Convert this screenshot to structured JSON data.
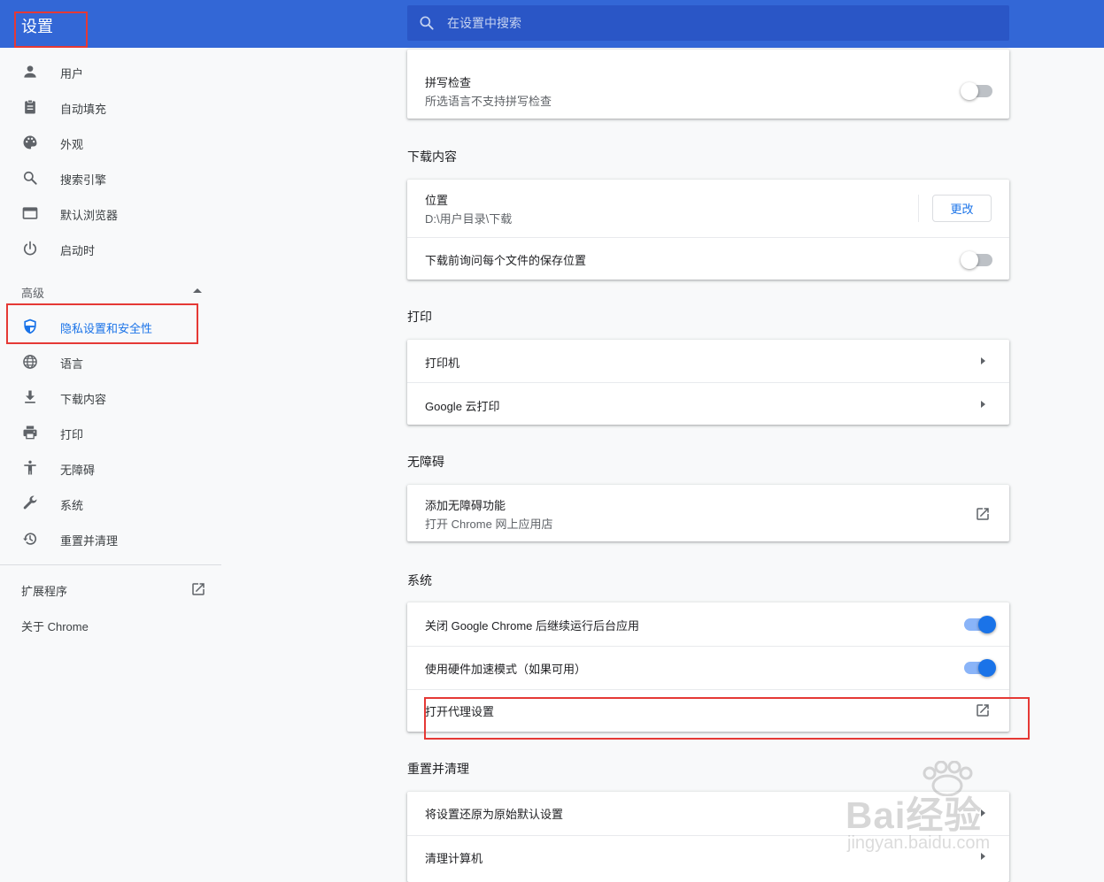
{
  "header": {
    "title": "设置",
    "search_placeholder": "在设置中搜索"
  },
  "sidebar": {
    "items": [
      {
        "label": "用户",
        "icon": "person-icon"
      },
      {
        "label": "自动填充",
        "icon": "clipboard-icon"
      },
      {
        "label": "外观",
        "icon": "palette-icon"
      },
      {
        "label": "搜索引擎",
        "icon": "search-icon"
      },
      {
        "label": "默认浏览器",
        "icon": "browser-window-icon"
      },
      {
        "label": "启动时",
        "icon": "power-icon"
      }
    ],
    "advanced_label": "高级",
    "advanced_items": [
      {
        "label": "隐私设置和安全性",
        "icon": "shield-icon",
        "active": true
      },
      {
        "label": "语言",
        "icon": "globe-icon"
      },
      {
        "label": "下载内容",
        "icon": "download-icon"
      },
      {
        "label": "打印",
        "icon": "printer-icon"
      },
      {
        "label": "无障碍",
        "icon": "accessibility-icon"
      },
      {
        "label": "系统",
        "icon": "wrench-icon"
      },
      {
        "label": "重置并清理",
        "icon": "restore-icon"
      }
    ],
    "extensions_label": "扩展程序",
    "about_label": "关于 Chrome"
  },
  "spellcheck": {
    "title": "拼写检查",
    "subtitle": "所选语言不支持拼写检查",
    "enabled": false
  },
  "downloads": {
    "section_title": "下载内容",
    "location_title": "位置",
    "location_path": "D:\\用户目录\\下载",
    "change_label": "更改",
    "ask_label": "下载前询问每个文件的保存位置",
    "ask_enabled": false
  },
  "printing": {
    "section_title": "打印",
    "printers_label": "打印机",
    "cloud_print_label": "Google 云打印"
  },
  "accessibility": {
    "section_title": "无障碍",
    "add_title": "添加无障碍功能",
    "add_subtitle": "打开 Chrome 网上应用店"
  },
  "system": {
    "section_title": "系统",
    "background_label": "关闭 Google Chrome 后继续运行后台应用",
    "background_enabled": true,
    "hw_accel_label": "使用硬件加速模式（如果可用）",
    "hw_accel_enabled": true,
    "proxy_label": "打开代理设置"
  },
  "reset": {
    "section_title": "重置并清理",
    "restore_label": "将设置还原为原始默认设置",
    "cleanup_label": "清理计算机"
  },
  "watermark": {
    "brand": "Bai经验",
    "url": "jingyan.baidu.com"
  },
  "colors": {
    "header_bg": "#3367d6",
    "accent": "#1a73e8",
    "highlight": "#e53935"
  }
}
